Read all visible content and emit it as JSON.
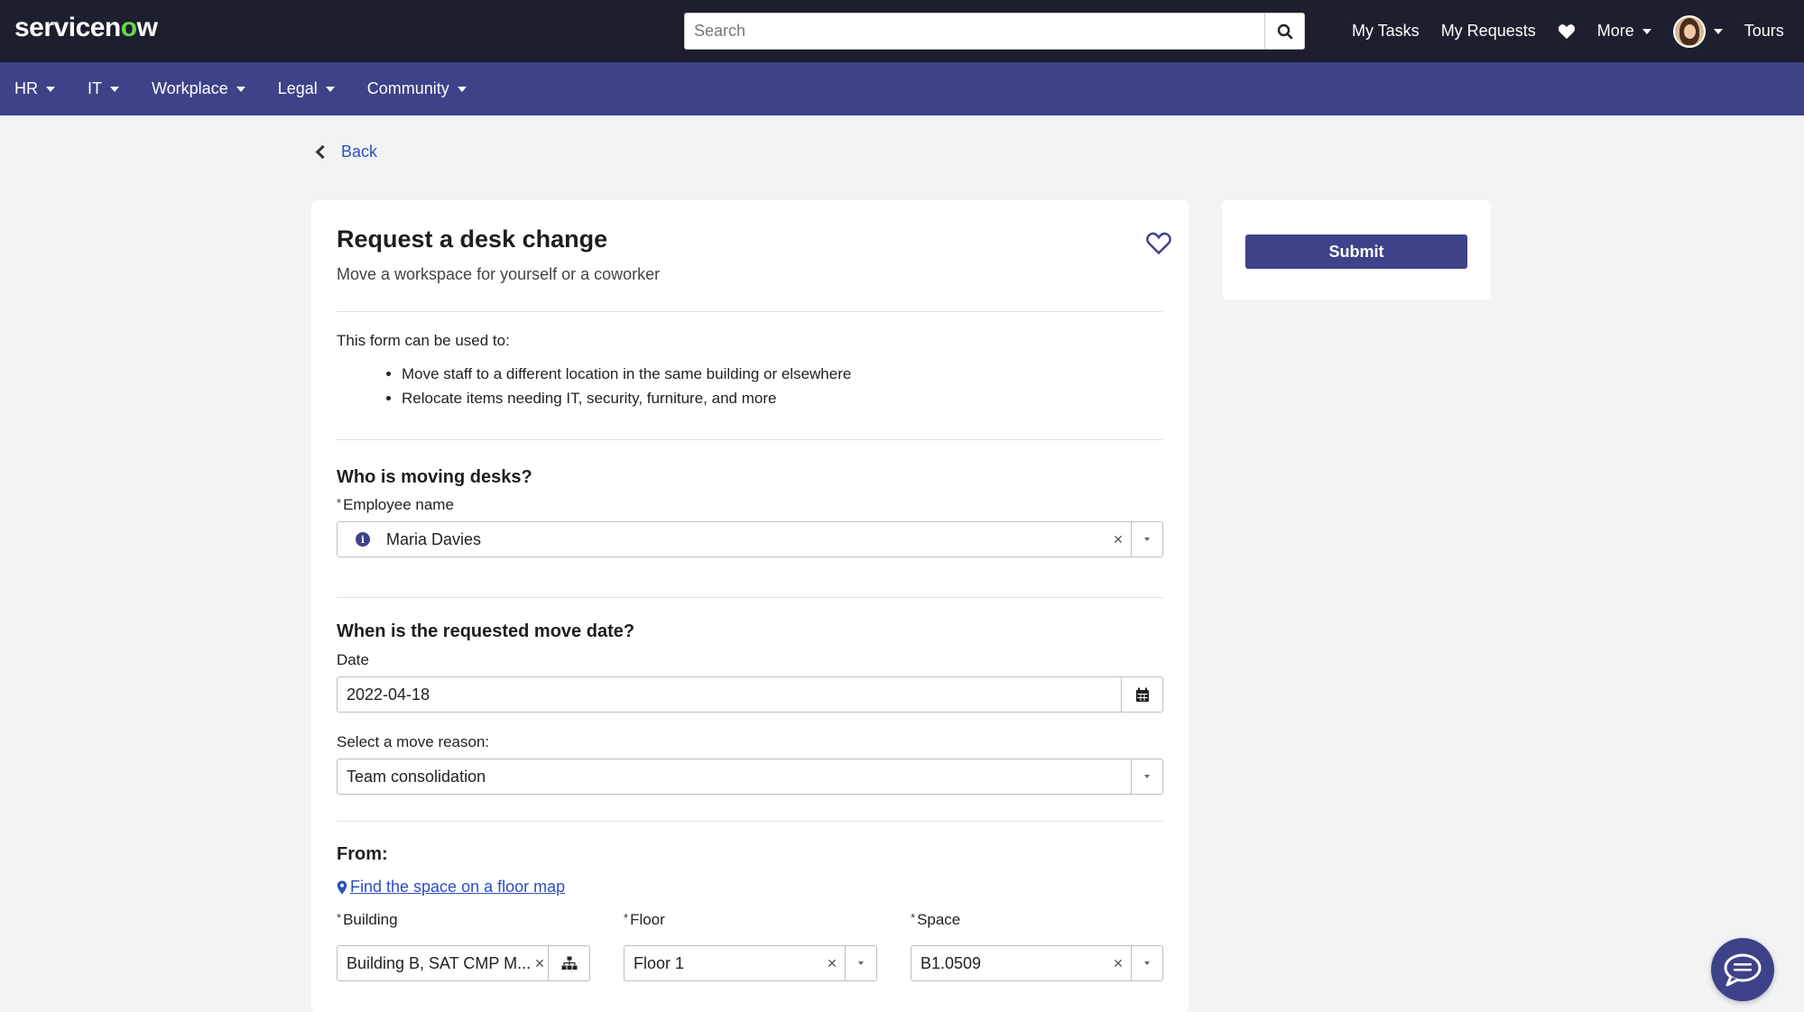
{
  "header": {
    "logo_text_a": "servicen",
    "logo_text_o": "o",
    "logo_text_b": "w",
    "search_placeholder": "Search",
    "nav": {
      "my_tasks": "My Tasks",
      "my_requests": "My Requests",
      "more": "More",
      "tours": "Tours"
    }
  },
  "subnav": {
    "items": [
      "HR",
      "IT",
      "Workplace",
      "Legal",
      "Community"
    ]
  },
  "back_label": "Back",
  "form": {
    "title": "Request a desk change",
    "subtitle": "Move a workspace for yourself or a coworker",
    "intro": "This form can be used to:",
    "bullets": [
      "Move staff to a different location in the same building or elsewhere",
      "Relocate items needing IT, security, furniture, and more"
    ],
    "who_heading": "Who is moving desks?",
    "employee_label": "Employee name",
    "employee_value": "Maria Davies",
    "date_heading": "When is the requested move date?",
    "date_label": "Date",
    "date_value": "2022-04-18",
    "reason_label": "Select a move reason:",
    "reason_value": "Team consolidation",
    "from_heading": "From:",
    "floor_map_link": "Find the space on a floor map",
    "building_label": "Building",
    "building_value": "Building B, SAT CMP M...",
    "floor_label": "Floor",
    "floor_value": "Floor 1",
    "space_label": "Space",
    "space_value": "B1.0509",
    "required_mark": "*"
  },
  "side": {
    "submit_label": "Submit"
  },
  "colors": {
    "header_bg": "#1d1f2e",
    "subnav_bg": "#3e4288",
    "accent": "#3e4288",
    "link": "#2d4fc0",
    "logo_o": "#62d84e"
  }
}
